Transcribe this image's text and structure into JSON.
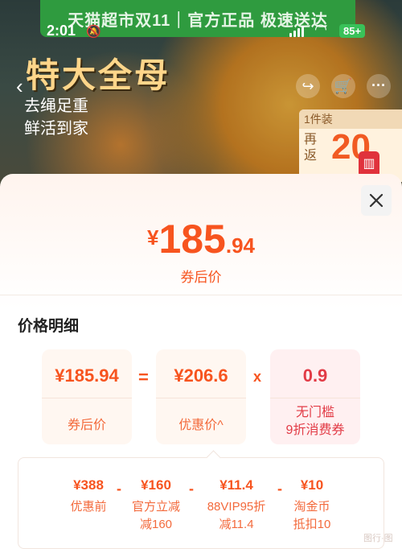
{
  "banner": {
    "text": "天猫超市双11｜官方正品 极速送达"
  },
  "status": {
    "time": "2:01",
    "battery": "85+"
  },
  "promo": {
    "title": "特大全母",
    "subtitle_1": "去绳足重",
    "subtitle_2": "鲜活到家",
    "side_top": "1件装",
    "side_left": "再\n返",
    "side_num": "20"
  },
  "sheet": {
    "price_yen": "¥",
    "price_int": "185",
    "price_dec": ".94",
    "price_label": "券后价",
    "detail_title": "价格明细"
  },
  "formula": {
    "after_coupon_value": "¥185.94",
    "after_coupon_label": "券后价",
    "equals": "=",
    "discount_value": "¥206.6",
    "discount_label": "优惠价^",
    "times": "x",
    "coupon_value": "0.9",
    "coupon_label_1": "无门槛",
    "coupon_label_2": "9折消费券"
  },
  "breakdown": [
    {
      "value": "¥388",
      "label_1": "优惠前",
      "label_2": ""
    },
    {
      "value": "¥160",
      "label_1": "官方立减",
      "label_2": "减160"
    },
    {
      "value": "¥11.4",
      "label_1": "88VIP95折",
      "label_2": "减11.4"
    },
    {
      "value": "¥10",
      "label_1": "淘金币",
      "label_2": "抵扣10"
    }
  ],
  "minus": "-",
  "watermark": "图行·图"
}
